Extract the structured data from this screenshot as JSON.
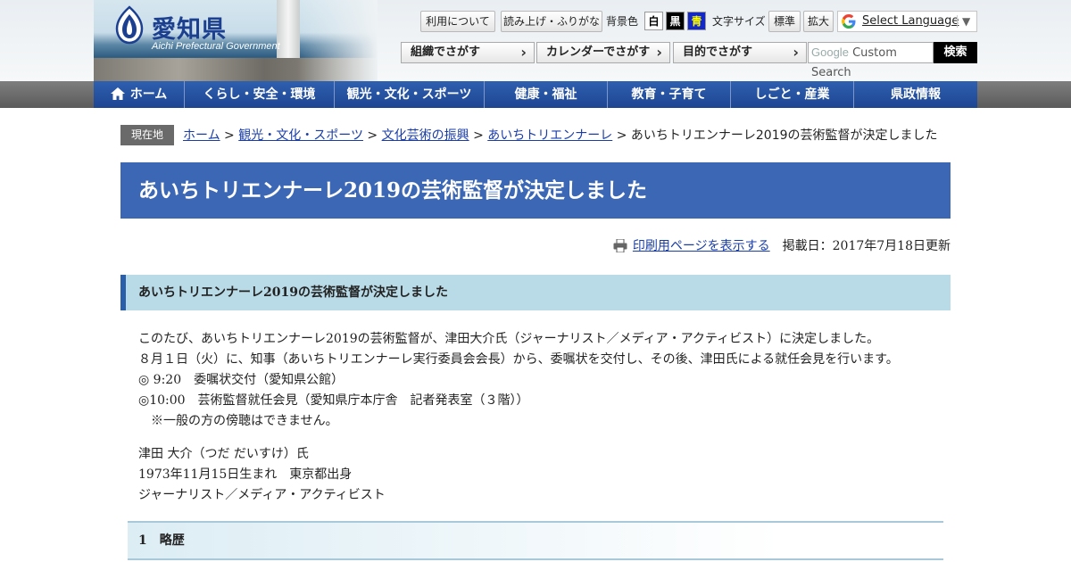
{
  "header": {
    "logo_jp": "愛知県",
    "logo_en": "Aichi Prefectural Government",
    "tools": {
      "usage": "利用について",
      "readaloud": "読み上げ・ふりがな",
      "bg_label": "背景色",
      "bg_white": "白",
      "bg_black": "黒",
      "bg_blue": "青",
      "fontsize_label": "文字サイズ",
      "font_standard": "標準",
      "font_large": "拡大"
    },
    "language": "Select Language",
    "language_arrow": "▼",
    "search_by": [
      "組織でさがす",
      "カレンダーでさがす",
      "目的でさがす"
    ],
    "search_placeholder": "Custom Search",
    "search_google": "Google",
    "search_button": "検索"
  },
  "nav": [
    "ホーム",
    "くらし・安全・環境",
    "観光・文化・スポーツ",
    "健康・福祉",
    "教育・子育て",
    "しごと・産業",
    "県政情報"
  ],
  "breadcrumb": {
    "badge": "現在地",
    "links": [
      "ホーム",
      "観光・文化・スポーツ",
      "文化芸術の振興",
      "あいちトリエンナーレ"
    ],
    "separator": ">",
    "current": "あいちトリエンナーレ2019の芸術監督が決定しました"
  },
  "page_title": "あいちトリエンナーレ2019の芸術監督が決定しました",
  "print_link": "印刷用ページを表示する",
  "posted": "掲載日：2017年7月18日更新",
  "section_heading": "あいちトリエンナーレ2019の芸術監督が決定しました",
  "paragraphs": [
    "このたび、あいちトリエンナーレ2019の芸術監督が、津田大介氏（ジャーナリスト／メディア・アクティビスト）に決定しました。",
    "８月１日（火）に、知事（あいちトリエンナーレ実行委員会会長）から、委嘱状を交付し、その後、津田氏による就任会見を行います。",
    "◎ 9:20　委嘱状交付（愛知県公館）",
    "◎10:00　芸術監督就任会見（愛知県庁本庁舎　記者発表室（３階））",
    "　※一般の方の傍聴はできません。"
  ],
  "profile": [
    "津田 大介（つだ だいすけ）氏",
    "1973年11月15日生まれ　東京都出身",
    "ジャーナリスト／メディア・アクティビスト"
  ],
  "subheading": "1　略歴",
  "colors": {
    "nav_blue": "#2f5fb0",
    "title_blue": "#3b67b4",
    "section_bg": "#b9dbe7",
    "link": "#1a3da6"
  }
}
